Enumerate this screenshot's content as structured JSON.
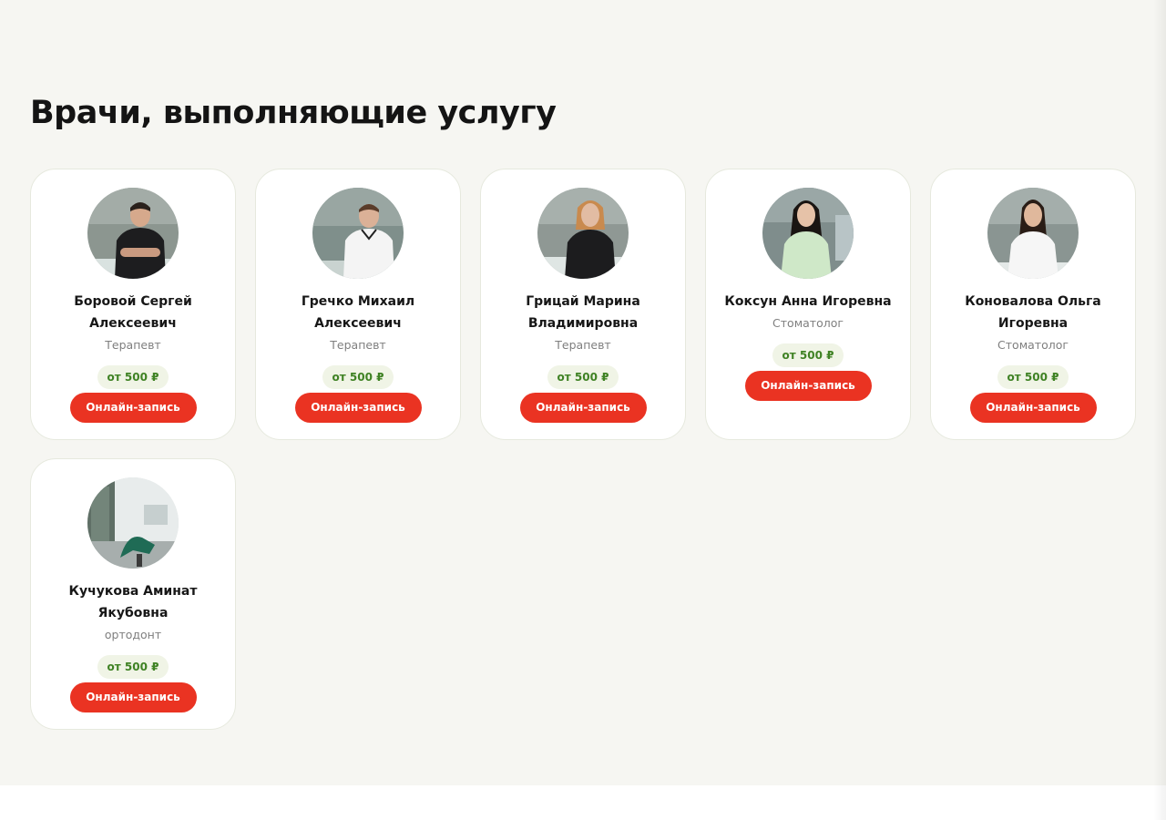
{
  "page": {
    "title": "Врачи, выполняющие услугу"
  },
  "colors": {
    "background": "#f6f6f2",
    "card": "#ffffff",
    "accent_button": "#ea3322",
    "price_text": "#3f8224",
    "price_bg": "#f0f4e6"
  },
  "doctors": [
    {
      "name": "Боровой Сергей Алексеевич",
      "role": "Терапевт",
      "price": "от 500 ₽",
      "button": "Онлайн-запись",
      "photo_icon": "doctor-photo"
    },
    {
      "name": "Гречко Михаил Алексеевич",
      "role": "Терапевт",
      "price": "от 500 ₽",
      "button": "Онлайн-запись",
      "photo_icon": "doctor-photo"
    },
    {
      "name": "Грицай Марина Владимировна",
      "role": "Терапевт",
      "price": "от 500 ₽",
      "button": "Онлайн-запись",
      "photo_icon": "doctor-photo"
    },
    {
      "name": "Коксун Анна Игоревна",
      "role": "Стоматолог",
      "price": "от 500 ₽",
      "button": "Онлайн-запись",
      "photo_icon": "doctor-photo"
    },
    {
      "name": "Коновалова Ольга Игоревна",
      "role": "Стоматолог",
      "price": "от 500 ₽",
      "button": "Онлайн-запись",
      "photo_icon": "doctor-photo"
    },
    {
      "name": "Кучукова Аминат Якубовна",
      "role": "ортодонт",
      "price": "от 500 ₽",
      "button": "Онлайн-запись",
      "photo_icon": "clinic-room-photo"
    }
  ]
}
